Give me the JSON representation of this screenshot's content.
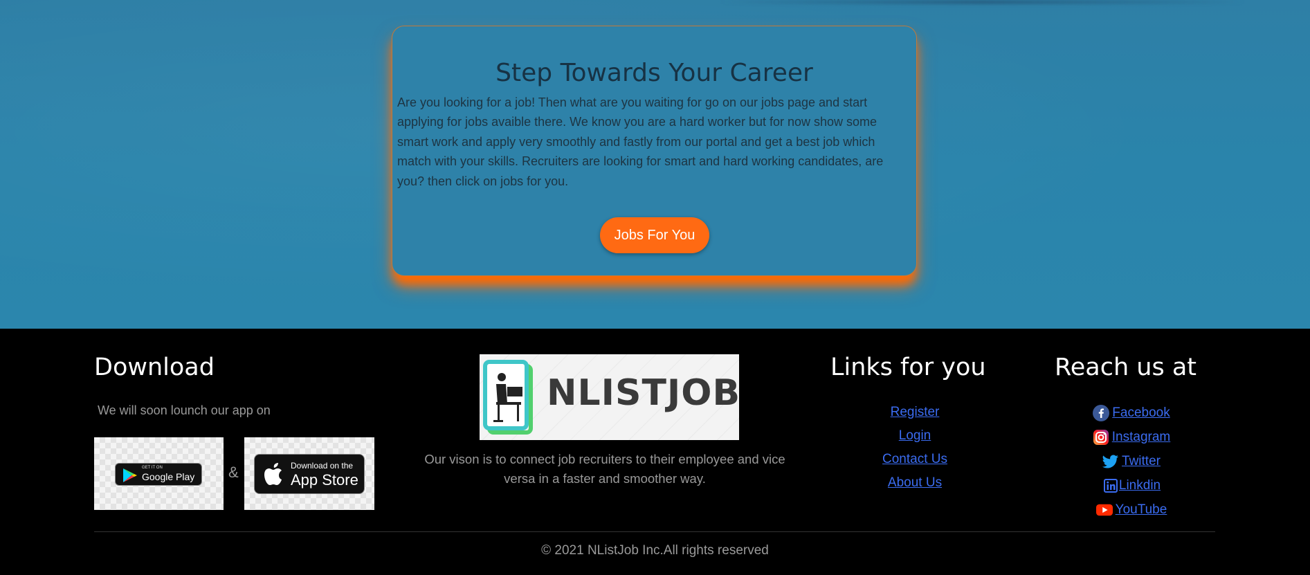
{
  "hero": {
    "card": {
      "title": "Step Towards Your Career",
      "body": "Are you looking for a job! Then what are you waiting for go on our jobs page and start applying for jobs avaible there. We know you are a hard worker but for now show some smart work and apply very smoothly and fastly from our portal and get a best job which match with your skills. Recruiters are looking for smart and hard working candidates, are you? then click on jobs for you.",
      "button_label": "Jobs For You"
    }
  },
  "footer": {
    "download": {
      "heading": "Download",
      "text": "We will soon lounch our app on",
      "separator": "&",
      "google_play": {
        "small": "GET IT ON",
        "big": "Google Play"
      },
      "app_store": {
        "small": "Download on the",
        "big": "App Store"
      }
    },
    "brand": {
      "logo_text": "NLISTJOB",
      "vision": "Our vison is to connect job recruiters to their employee and vice versa in a faster and smoother way."
    },
    "links": {
      "heading": "Links for you",
      "items": [
        {
          "label": "Register"
        },
        {
          "label": "Login"
        },
        {
          "label": "Contact Us"
        },
        {
          "label": "About Us"
        }
      ]
    },
    "reach": {
      "heading": "Reach us at",
      "items": [
        {
          "label": "Facebook",
          "icon": "facebook-icon"
        },
        {
          "label": "Instagram",
          "icon": "instagram-icon"
        },
        {
          "label": "Twitter",
          "icon": "twitter-icon"
        },
        {
          "label": "Linkdin",
          "icon": "linkedin-icon"
        },
        {
          "label": "YouTube",
          "icon": "youtube-icon"
        }
      ]
    },
    "copyright": "© 2021 NListJob Inc.All rights reserved"
  },
  "colors": {
    "hero_bg": "#2b86ad",
    "accent": "#ff6a13",
    "link": "#3b6cf0",
    "footer_bg": "#000000",
    "muted_text": "#9a9a9a"
  }
}
